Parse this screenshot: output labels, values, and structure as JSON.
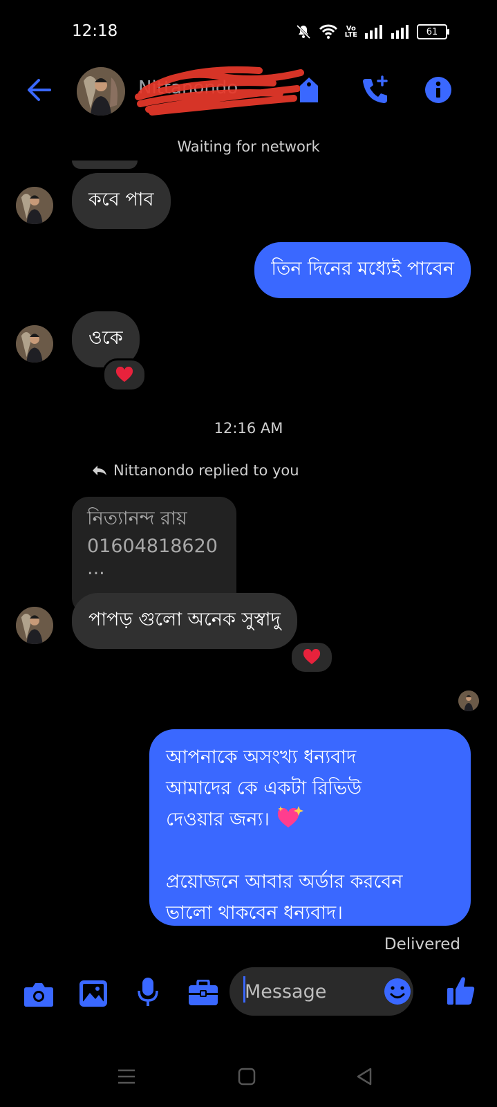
{
  "status_bar": {
    "time": "12:18",
    "battery": "61",
    "volte": "Vo\nLTE"
  },
  "header": {
    "contact_name": "Nittanondo"
  },
  "network_status": "Waiting for network",
  "messages": {
    "m1": "কবে পাব",
    "m2": "তিন দিনের মধ্যেই পাবেন",
    "m3": "ওকে",
    "timestamp": "12:16 AM",
    "reply_note": "Nittanondo replied to you",
    "quoted_line1": "নিত্যানন্দ রায়",
    "quoted_line2": "01604818620",
    "quoted_line3": "...",
    "m4": "পাপড় গুলো অনেক সুস্বাদু",
    "m5_line1": "আপনাকে অসংখ্য ধন্যবাদ",
    "m5_line2": "আমাদের কে একটা রিভিউ",
    "m5_line3": "দেওয়ার জন্য।",
    "m5_line4": "প্রয়োজনে আবার অর্ডার করবেন",
    "m5_line5": "ভালো থাকবেন ধন্যবাদ।",
    "delivered": "Delivered"
  },
  "composer": {
    "placeholder": "Message"
  },
  "colors": {
    "accent": "#3a68ff",
    "incoming_bubble": "#303030",
    "outgoing_bubble": "#3a68ff",
    "heart": "#e8223c"
  }
}
